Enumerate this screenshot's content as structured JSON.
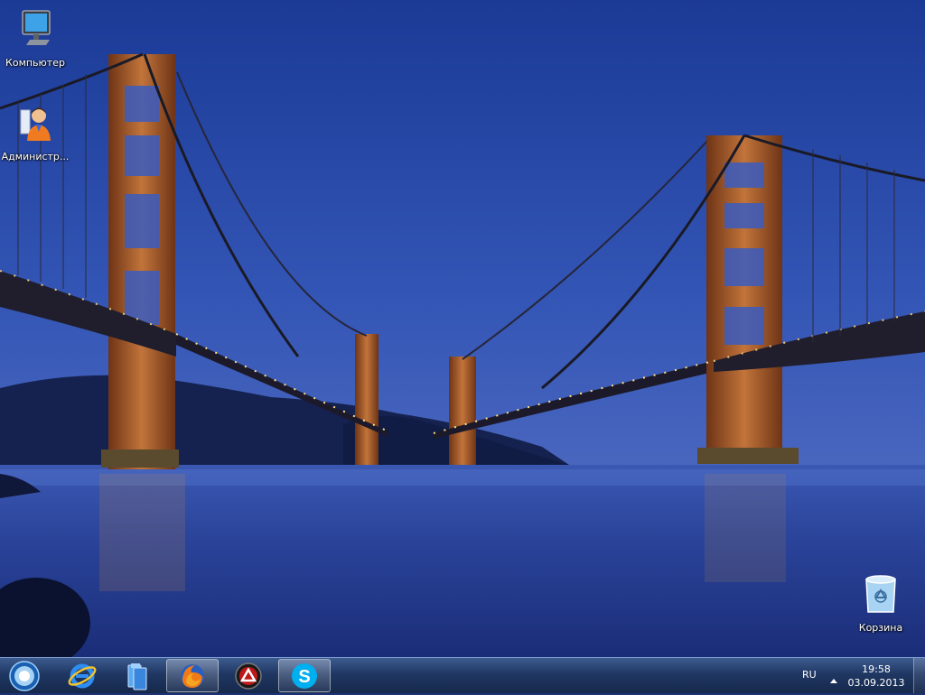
{
  "desktop": {
    "icons": [
      {
        "label": "Компьютер",
        "icon": "computer-icon"
      },
      {
        "label": "Администр...",
        "icon": "user-folder-icon"
      },
      {
        "label": "Корзина",
        "icon": "recycle-bin-icon"
      }
    ]
  },
  "taskbar": {
    "start": {
      "icon": "windows-orb-icon"
    },
    "pinned": [
      {
        "icon": "internet-explorer-icon",
        "active": false
      },
      {
        "icon": "file-explorer-icon",
        "active": false
      },
      {
        "icon": "firefox-icon",
        "active": true
      },
      {
        "icon": "app-triangle-icon",
        "active": false
      },
      {
        "icon": "skype-icon",
        "active": true
      }
    ],
    "tray": {
      "language": "RU",
      "expand_icon": "triangle-up-icon",
      "time": "19:58",
      "date": "03.09.2013"
    }
  },
  "colors": {
    "sky_top": "#1b3a96",
    "sky_mid": "#3355b5",
    "water": "#243a8a",
    "bridge": "#b4652e",
    "taskbar": "#1f3762"
  }
}
